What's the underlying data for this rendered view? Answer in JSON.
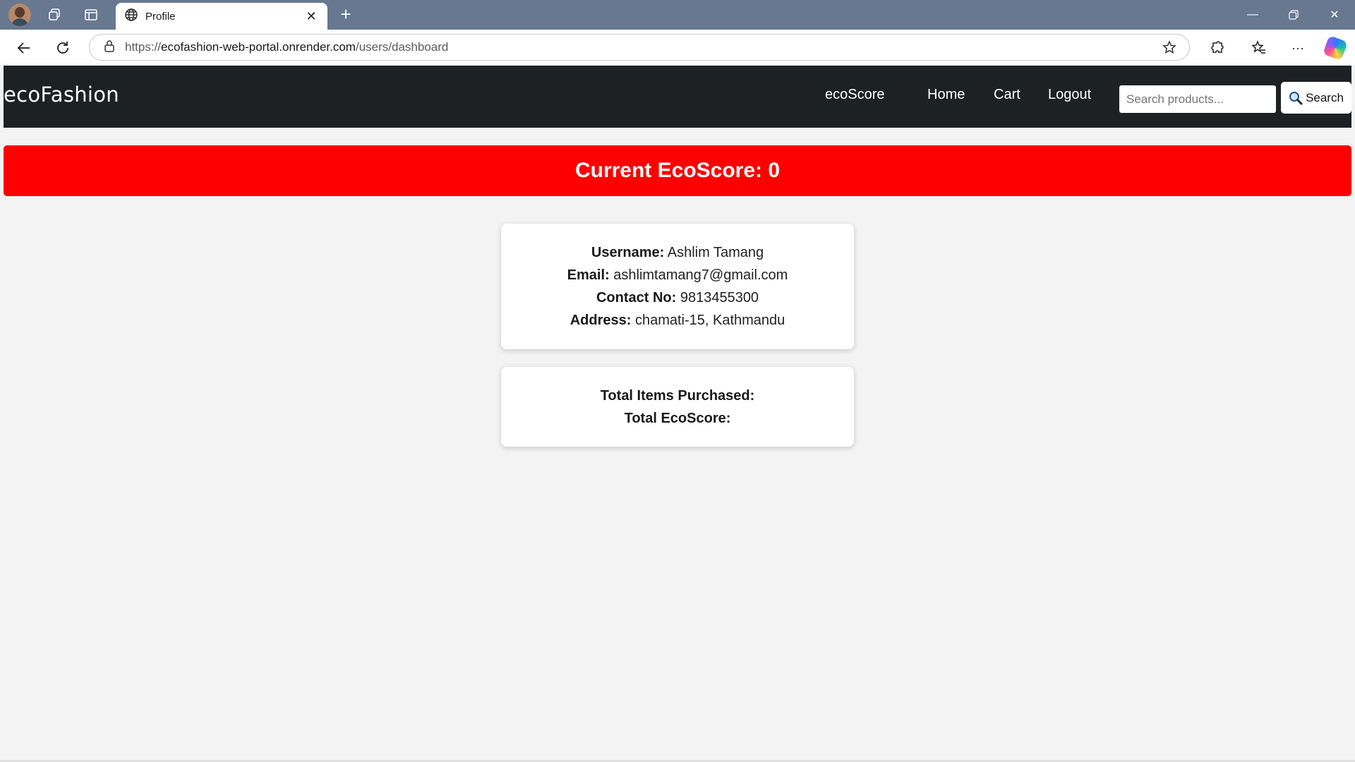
{
  "browser": {
    "tab_title": "Profile",
    "url_prefix": "https://",
    "url_domain": "ecofashion-web-portal.onrender.com",
    "url_path": "/users/dashboard"
  },
  "navbar": {
    "brand": "ecoFashion",
    "links": [
      "ecoScore",
      "Home",
      "Cart",
      "Logout"
    ],
    "search_placeholder": "Search products...",
    "search_button": "Search"
  },
  "banner": {
    "text": "Current EcoScore: 0",
    "color": "#ff0000"
  },
  "profile": {
    "username_label": "Username:",
    "username": "Ashlim Tamang",
    "email_label": "Email:",
    "email": "ashlimtamang7@gmail.com",
    "contact_label": "Contact No:",
    "contact": "9813455300",
    "address_label": "Address:",
    "address": "chamati-15, Kathmandu"
  },
  "stats": {
    "items_label": "Total Items Purchased:",
    "items_value": "",
    "ecoscore_label": "Total EcoScore:",
    "ecoscore_value": ""
  }
}
